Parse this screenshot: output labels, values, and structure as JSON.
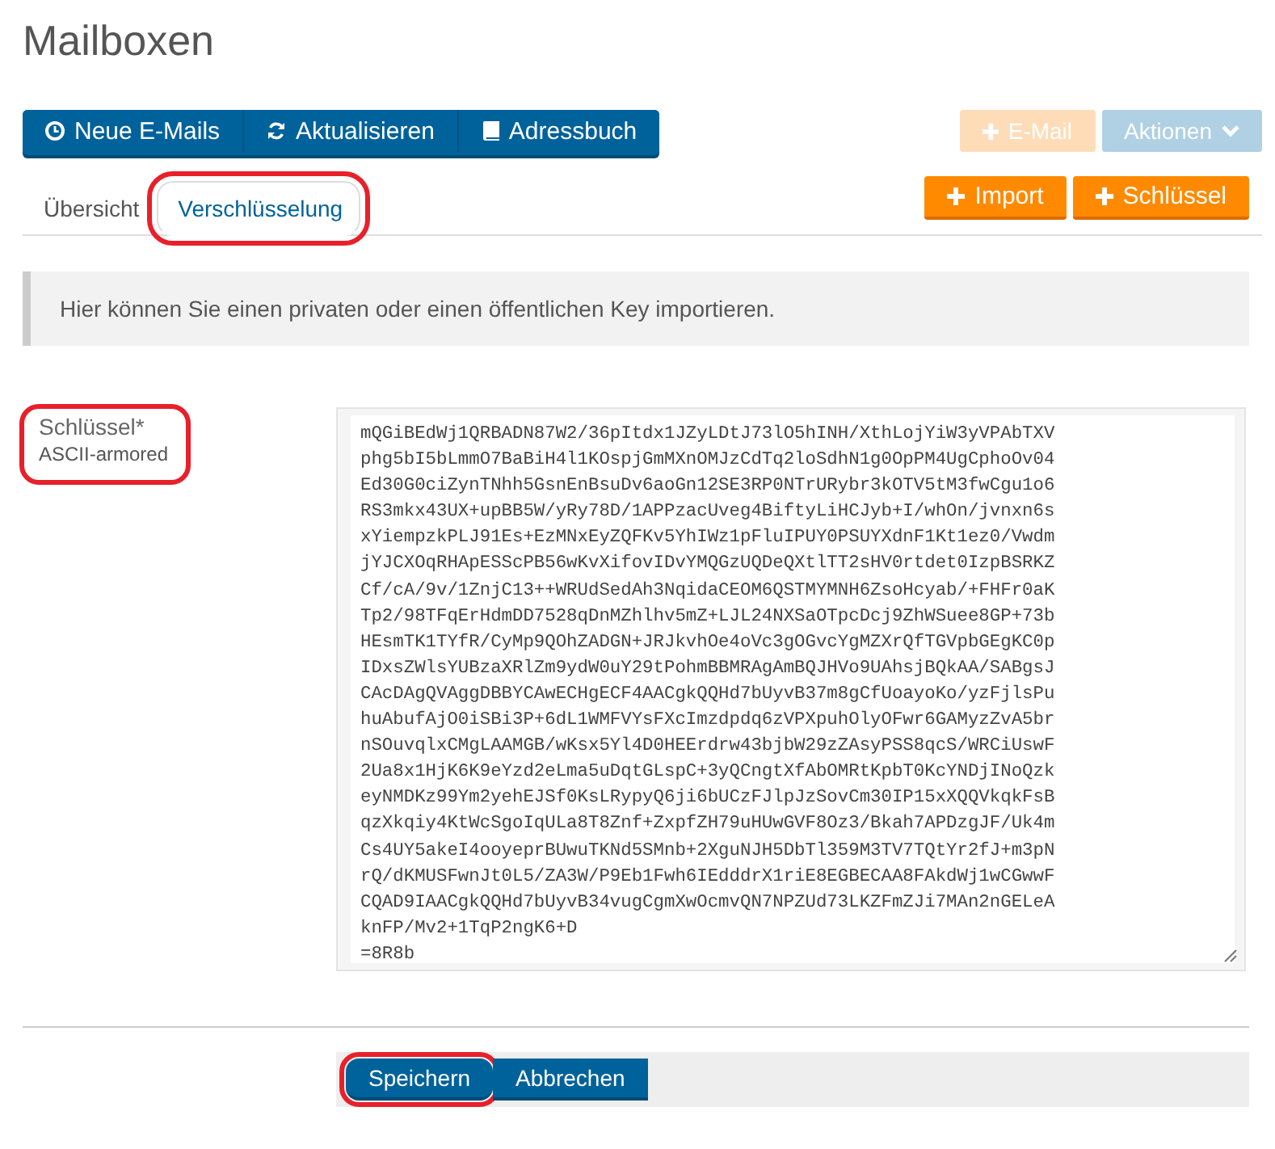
{
  "page_title": "Mailboxen",
  "toolbar": {
    "left": [
      {
        "kind": "clock",
        "label": "Neue E-Mails"
      },
      {
        "kind": "refresh",
        "label": "Aktualisieren"
      },
      {
        "kind": "book",
        "label": "Adressbuch"
      }
    ],
    "right": [
      {
        "kind": "plus",
        "label": "E-Mail",
        "disabled": true
      },
      {
        "kind": "caret",
        "label": "Aktionen",
        "disabled": true
      }
    ]
  },
  "tabs": [
    {
      "label": "Übersicht",
      "selected": false,
      "highlighted": false
    },
    {
      "label": "Verschlüsselung",
      "selected": true,
      "highlighted": true
    }
  ],
  "tab_actions": [
    {
      "label": "Import"
    },
    {
      "label": "Schlüssel"
    }
  ],
  "info": "Hier können Sie einen privaten oder einen öffentlichen Key importieren.",
  "field": {
    "label": "Schlüssel*",
    "hint": "ASCII-armored",
    "highlighted": true,
    "value": [
      "mQGiBEdWj1QRBADN87W2/36pItdx1JZyLDtJ73lO5hINH/XthLojYiW3yVPAbTXV",
      "phg5bI5bLmmO7BaBiH4l1KOspjGmMXnOMJzCdTq2loSdhN1g0OpPM4UgCphoOv04",
      "Ed30G0ciZynTNhh5GsnEnBsuDv6aoGn12SE3RP0NTrURybr3kOTV5tM3fwCgu1o6",
      "RS3mkx43UX+upBB5W/yRy78D/1APPzacUveg4BiftyLiHCJyb+I/whOn/jvnxn6s",
      "xYiempzkPLJ91Es+EzMNxEyZQFKv5YhIWz1pFluIPUY0PSUYXdnF1Kt1ez0/Vwdm",
      "jYJCXOqRHApESScPB56wKvXifovIDvYMQGzUQDeQXtlTT2sHV0rtdet0IzpBSRKZ",
      "Cf/cA/9v/1ZnjC13++WRUdSedAh3NqidaCEOM6QSTMYMNH6ZsoHcyab/+FHFr0aK",
      "Tp2/98TFqErHdmDD7528qDnMZhlhv5mZ+LJL24NXSaOTpcDcj9ZhWSuee8GP+73b",
      "HEsmTK1TYfR/CyMp9QOhZADGN+JRJkvhOe4oVc3gOGvcYgMZXrQfTGVpbGEgKC0p",
      "IDxsZWlsYUBzaXRlZm9ydW0uY29tPohmBBMRAgAmBQJHVo9UAhsjBQkAA/SABgsJ",
      "CAcDAgQVAggDBBYCAwECHgECF4AACgkQQHd7bUyvB37m8gCfUoayoKo/yzFjlsPu",
      "huAbufAjO0iSBi3P+6dL1WMFVYsFXcImzdpdq6zVPXpuhOlyOFwr6GAMyzZvA5br",
      "nSOuvqlxCMgLAAMGB/wKsx5Yl4D0HEErdrw43bjbW29zZAsyPSS8qcS/WRCiUswF",
      "2Ua8x1HjK6K9eYzd2eLma5uDqtGLspC+3yQCngtXfAbOMRtKpbT0KcYNDjINoQzk",
      "eyNMDKz99Ym2yehEJSf0KsLRypyQ6ji6bUCzFJlpJzSovCm30IP15xXQQVkqkFsB",
      "qzXkqiy4KtWcSgoIqULa8T8Znf+ZxpfZH79uHUwGVF8Oz3/Bkah7APDzgJF/Uk4m",
      "Cs4UY5akeI4ooyeprBUwuTKNd5SMnb+2XguNJH5DbTl359M3TV7TQtYr2fJ+m3pN",
      "rQ/dKMUSFwnJt0L5/ZA3W/P9Eb1Fwh6IEdddrX1riE8EGBECAA8FAkdWj1wCGwwF",
      "CQAD9IAACgkQQHd7bUyvB34vugCgmXwOcmvQN7NPZUd73LKZFmZJi7MAn2nGELeA",
      "knFP/Mv2+1TqP2ngK6+D",
      "=8R8b"
    ]
  },
  "form_buttons": [
    {
      "label": "Speichern",
      "highlighted": true
    },
    {
      "label": "Abbrechen",
      "highlighted": false
    }
  ]
}
